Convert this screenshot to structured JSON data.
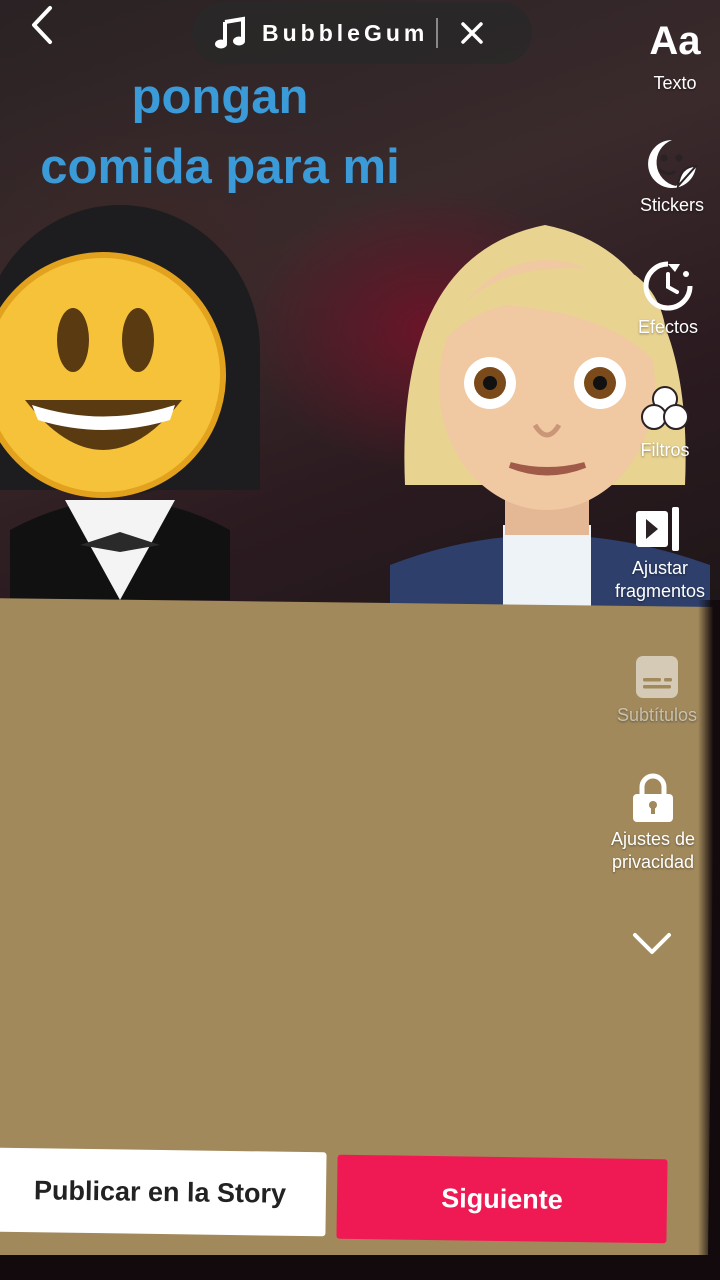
{
  "music": {
    "song": "BubbleGum"
  },
  "caption": {
    "line1": "pongan",
    "line2": "comida para mi"
  },
  "tools": [
    {
      "label": "Texto",
      "icon": "text-aa-icon"
    },
    {
      "label": "Stickers",
      "icon": "sticker-icon"
    },
    {
      "label": "Efectos",
      "icon": "effects-timer-icon"
    },
    {
      "label": "Filtros",
      "icon": "filters-icon"
    },
    {
      "label": "Ajustar fragmentos",
      "icon": "adjust-clips-icon"
    },
    {
      "label": "Subtítulos",
      "icon": "captions-icon"
    },
    {
      "label": "Ajustes de privacidad",
      "icon": "lock-icon"
    }
  ],
  "text_tool_glyph": "Aa",
  "actions": {
    "story": "Publicar en la Story",
    "next": "Siguiente"
  },
  "colors": {
    "caption": "#3b9ad8",
    "accent": "#ef1a53",
    "panel": "#a1895b"
  }
}
